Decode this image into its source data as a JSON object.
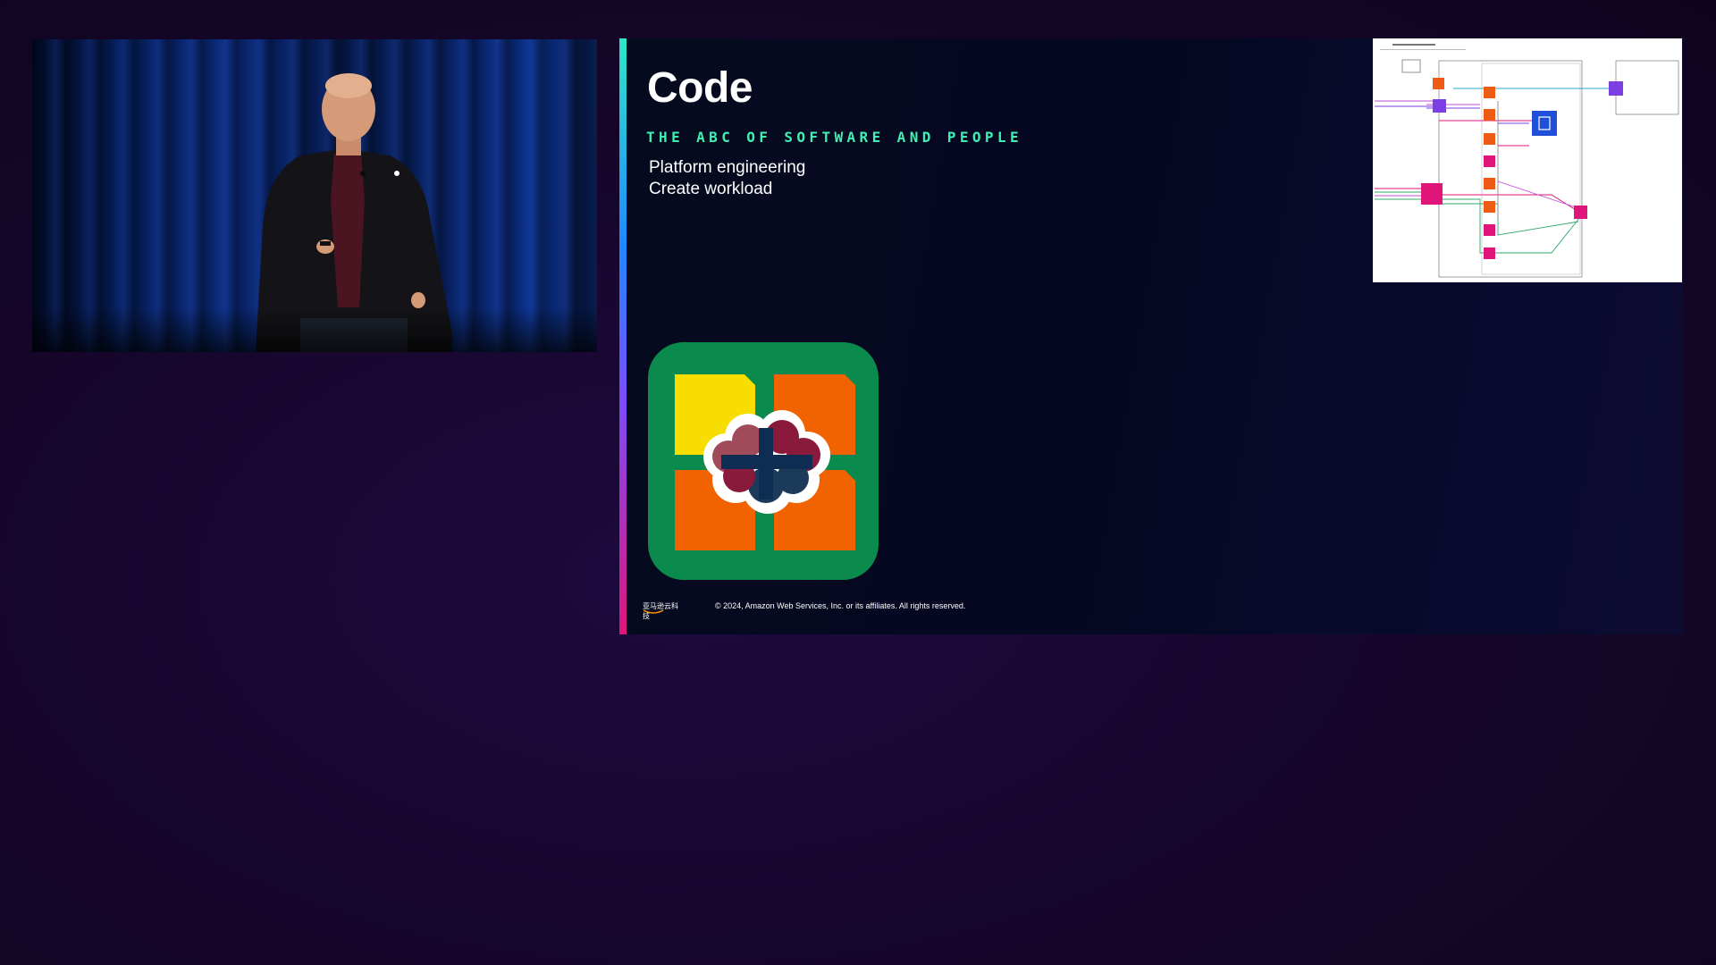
{
  "speaker_video": {
    "description_icon": "speaker-on-stage"
  },
  "slide": {
    "title": "Code",
    "subtitle": "THE ABC OF SOFTWARE AND PEOPLE",
    "bullets": [
      "Platform engineering",
      "Create workload"
    ],
    "footer_logo_text": "亚马逊云科技",
    "copyright": "© 2024, Amazon Web Services, Inc. or its affiliates. All rights reserved.",
    "colors": {
      "accent_bar_top": "#2ee6c8",
      "accent_bar_bottom": "#e0157a",
      "subtitle": "#3ff0b2",
      "logo_bg": "#0b8a4d",
      "logo_yellow": "#f7dd00",
      "logo_orange": "#f06300"
    }
  },
  "architecture_diagram": {
    "icon_names": [
      "lambda-icon",
      "api-gateway-icon",
      "dynamodb-icon",
      "eventbridge-icon",
      "step-functions-icon"
    ],
    "colors": {
      "lambda": "#ed5b14",
      "api_gateway": "#7b3fe4",
      "database": "#1f4fd8",
      "integration": "#e0157a"
    }
  }
}
